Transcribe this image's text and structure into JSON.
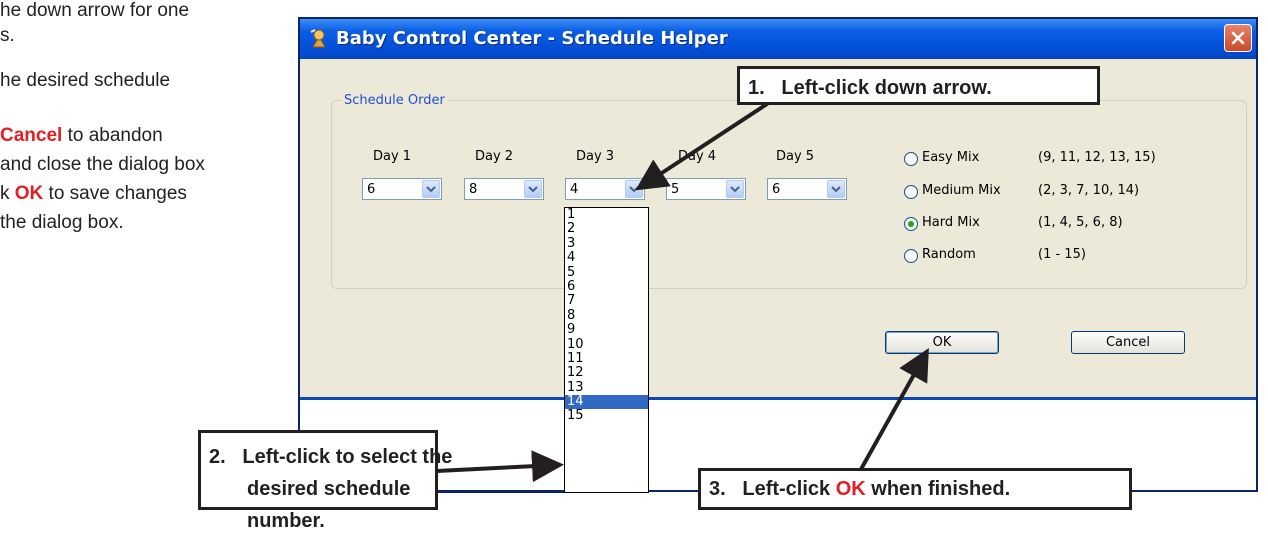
{
  "instructions": {
    "line1": "he down arrow for one",
    "line2": "s.",
    "line3": "he desired schedule",
    "line4_red": "Cancel",
    "line4_rest": " to abandon",
    "line5": "and close the dialog box",
    "line6_pre": "k ",
    "line6_red": "OK",
    "line6_rest": " to save changes",
    "line7": "the dialog box."
  },
  "dialog": {
    "title": "Baby Control Center - Schedule Helper",
    "group_label": "Schedule Order",
    "days": [
      {
        "label": "Day 1",
        "value": "6"
      },
      {
        "label": "Day 2",
        "value": "8"
      },
      {
        "label": "Day 3",
        "value": "4"
      },
      {
        "label": "Day 4",
        "value": "5"
      },
      {
        "label": "Day 5",
        "value": "6"
      }
    ],
    "mixes": [
      {
        "label": "Easy Mix",
        "set": "(9, 11, 12, 13, 15)",
        "selected": false
      },
      {
        "label": "Medium Mix",
        "set": "(2, 3, 7, 10, 14)",
        "selected": false
      },
      {
        "label": "Hard Mix",
        "set": "(1, 4, 5, 6, 8)",
        "selected": true
      },
      {
        "label": "Random",
        "set": "(1 - 15)",
        "selected": false
      }
    ],
    "ok_label": "OK",
    "cancel_label": "Cancel",
    "dropdown_options": [
      "1",
      "2",
      "3",
      "4",
      "5",
      "6",
      "7",
      "8",
      "9",
      "10",
      "11",
      "12",
      "13",
      "14",
      "15"
    ],
    "dropdown_selected": "14"
  },
  "callouts": {
    "c1": "1.   Left-click down arrow.",
    "c2_line1": "2.   Left-click to select the",
    "c2_line2": "desired schedule number.",
    "c3_pre": "3.   Left-click ",
    "c3_red": "OK",
    "c3_post": " when finished."
  },
  "colors": {
    "accent_red": "#e31e24",
    "titlebar_blue": "#0550d8",
    "highlight": "#316ac5"
  }
}
